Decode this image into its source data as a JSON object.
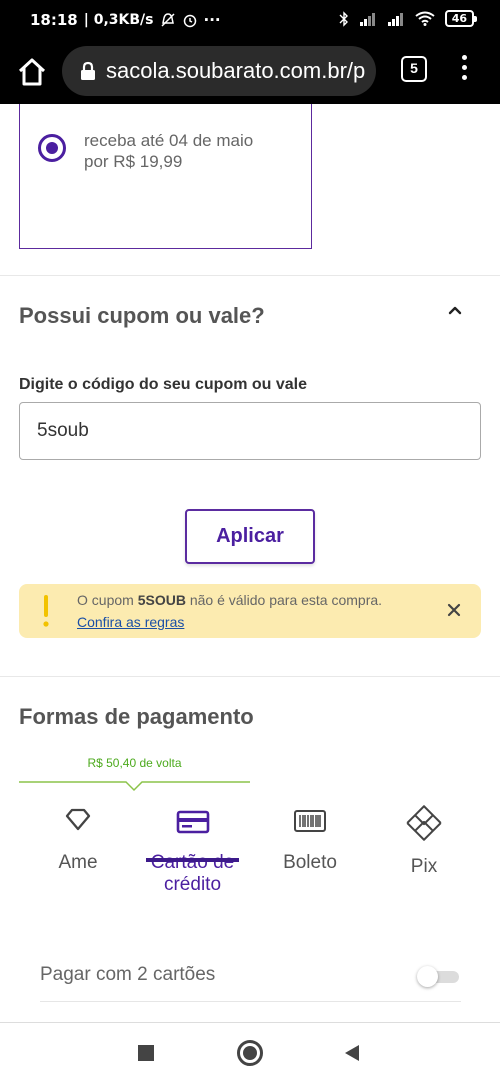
{
  "status_bar": {
    "time": "18:18",
    "speed": "| 0,3KB/s",
    "dots": "···",
    "battery": "46"
  },
  "browser": {
    "url": "sacola.soubarato.com.br/p",
    "tab_count": "5"
  },
  "shipping": {
    "line1": "receba até 04 de maio",
    "line2": "por R$ 19,99"
  },
  "coupon": {
    "title": "Possui cupom ou vale?",
    "field_label": "Digite o código do seu cupom ou vale",
    "field_value": "5soub",
    "apply_label": "Aplicar",
    "alert_prefix": "O cupom ",
    "alert_code": "5SOUB",
    "alert_suffix": " não é válido para esta compra.",
    "alert_link": "Confira as regras"
  },
  "payment": {
    "title": "Formas de pagamento",
    "cashback": "R$ 50,40 de volta",
    "tabs": [
      {
        "label": "Ame",
        "icon": "heart-diamond-icon"
      },
      {
        "label": "Cartão de crédito",
        "line1": "Cartão de",
        "line2": "crédito",
        "icon": "credit-card-icon",
        "active": true
      },
      {
        "label": "Boleto",
        "icon": "barcode-icon"
      },
      {
        "label": "Pix",
        "icon": "pix-icon"
      }
    ],
    "two_cards_label": "Pagar com 2 cartões",
    "two_cards_enabled": false
  },
  "colors": {
    "accent_purple": "#4b1fa0",
    "cashback_green": "#4caa1d",
    "alert_yellow": "#fcebb0"
  }
}
